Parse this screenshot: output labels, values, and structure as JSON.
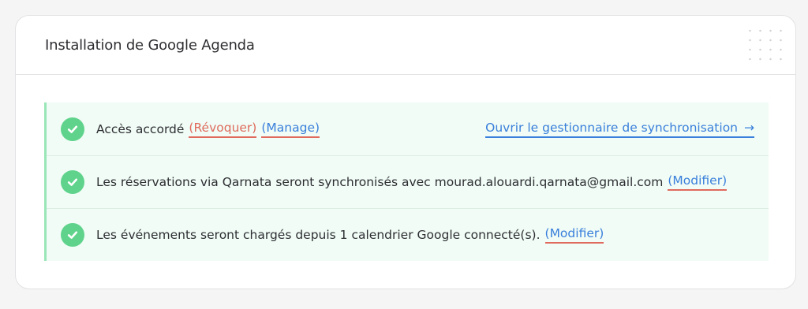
{
  "header": {
    "title": "Installation de Google Agenda"
  },
  "rows": [
    {
      "text": "Accès accordé",
      "revoke_label": "(Révoquer)",
      "manage_label": "(Manage)",
      "sync_manager_label": "Ouvrir le gestionnaire de synchronisation",
      "sync_manager_arrow": "→"
    },
    {
      "text": "Les réservations via Qarnata seront synchronisés avec mourad.alouardi.qarnata@gmail.com",
      "modify_label": "(Modifier)"
    },
    {
      "text": "Les événements seront chargés depuis 1 calendrier Google connecté(s).",
      "modify_label": "(Modifier)"
    }
  ],
  "colors": {
    "success": "#5fd38c",
    "link": "#3a7fdc",
    "danger": "#e06a5d",
    "panel_bg": "#f0fcf5"
  },
  "icons": [
    "check-circle-icon",
    "arrow-right-icon",
    "dot-grid-decoration"
  ]
}
